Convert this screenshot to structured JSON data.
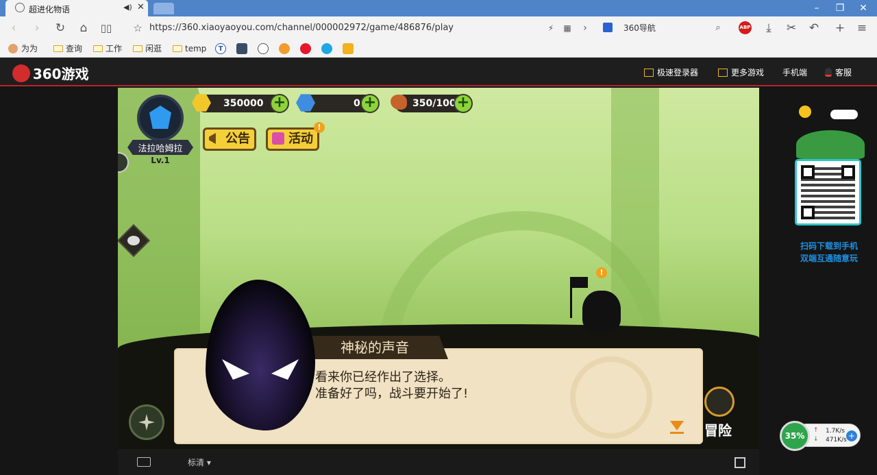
{
  "browser": {
    "tab_title": "超进化物语",
    "url": "https://360.xiaoyaoyou.com/channel/000002972/game/486876/play",
    "search_engine_label": "360导航",
    "bookmarks": [
      "为为",
      "查询",
      "工作",
      "闲逛",
      "temp"
    ],
    "minimize": "–",
    "maximize": "❐",
    "close": "✕"
  },
  "site": {
    "logo": "360游戏",
    "nav": [
      "极速登录器",
      "更多游戏",
      "手机端",
      "客服"
    ]
  },
  "game": {
    "player_name": "法拉哈姆拉",
    "player_level": "Lv.1",
    "gold": "350000",
    "gems": "0",
    "stamina": "350/100",
    "notice_button": "公告",
    "event_button": "活动",
    "speaker": "神秘的声音",
    "dialog_lines": [
      "看来你已经作出了选择。",
      "准备好了吗，战斗要开始了!"
    ],
    "adventure_button": "冒险"
  },
  "game_toolbar": {
    "quality_label": "标清 ▾"
  },
  "sidebar": {
    "qr_line1": "扫码下载到手机",
    "qr_line2": "双端互通随意玩"
  },
  "net_monitor": {
    "cpu": "35%",
    "upload": "1.7K/s",
    "download": "471K/s"
  },
  "colors": {
    "accent_red": "#b8242a",
    "title_bar_blue": "#4f84c8",
    "game_yellow": "#f5cf3a",
    "plus_green": "#8ed33b"
  }
}
